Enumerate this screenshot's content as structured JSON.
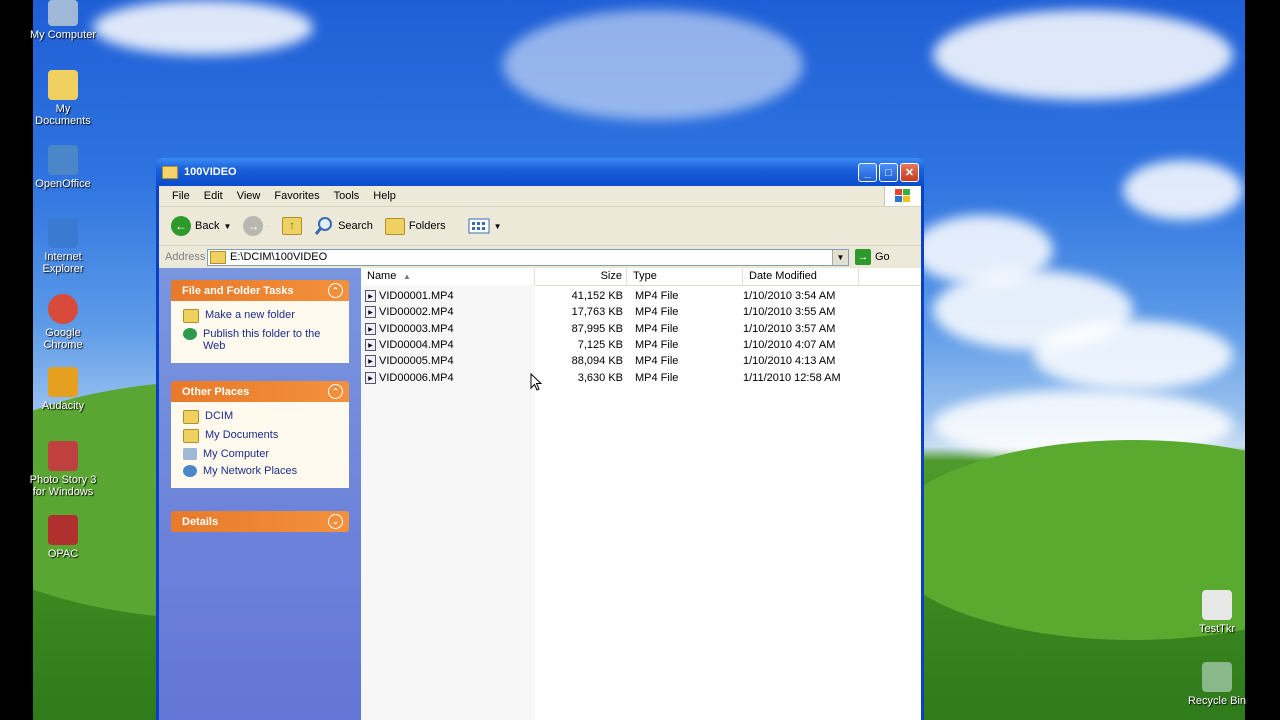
{
  "desktop": {
    "icons": [
      {
        "label": "My Computer",
        "icon": "computer-icon",
        "color": "#9fb8d8"
      },
      {
        "label": "My Documents",
        "icon": "documents-icon",
        "color": "#f0d060"
      },
      {
        "label": "OpenOffice",
        "icon": "openoffice-icon",
        "color": "#4a86c8"
      },
      {
        "label": "Internet Explorer",
        "icon": "ie-icon",
        "color": "#3a7ad0"
      },
      {
        "label": "Google Chrome",
        "icon": "chrome-icon",
        "color": "#d84a3a"
      },
      {
        "label": "Audacity",
        "icon": "audacity-icon",
        "color": "#e6a020"
      },
      {
        "label": "Photo Story 3 for Windows",
        "icon": "photostory-icon",
        "color": "#c04040"
      },
      {
        "label": "OPAC",
        "icon": "opac-icon",
        "color": "#b03030"
      },
      {
        "label": "TestTkr",
        "icon": "testtkr-icon",
        "color": "#e8e8e8"
      },
      {
        "label": "Recycle Bin",
        "icon": "recycle-bin-icon",
        "color": "#8ab88a"
      }
    ]
  },
  "window": {
    "title": "100VIDEO",
    "menu": [
      "File",
      "Edit",
      "View",
      "Favorites",
      "Tools",
      "Help"
    ],
    "toolbar": {
      "back": "Back",
      "search": "Search",
      "folders": "Folders"
    },
    "address": {
      "label": "Address",
      "value": "E:\\DCIM\\100VIDEO",
      "go": "Go"
    },
    "tasks_panel": {
      "title": "File and Folder Tasks",
      "items": [
        "Make a new folder",
        "Publish this folder to the Web"
      ]
    },
    "places_panel": {
      "title": "Other Places",
      "items": [
        "DCIM",
        "My Documents",
        "My Computer",
        "My Network Places"
      ]
    },
    "details_panel": {
      "title": "Details"
    },
    "columns": {
      "name": "Name",
      "size": "Size",
      "type": "Type",
      "date": "Date Modified"
    },
    "files": [
      {
        "name": "VID00001.MP4",
        "size": "41,152 KB",
        "type": "MP4 File",
        "date": "1/10/2010 3:54 AM"
      },
      {
        "name": "VID00002.MP4",
        "size": "17,763 KB",
        "type": "MP4 File",
        "date": "1/10/2010 3:55 AM"
      },
      {
        "name": "VID00003.MP4",
        "size": "87,995 KB",
        "type": "MP4 File",
        "date": "1/10/2010 3:57 AM"
      },
      {
        "name": "VID00004.MP4",
        "size": "7,125 KB",
        "type": "MP4 File",
        "date": "1/10/2010 4:07 AM"
      },
      {
        "name": "VID00005.MP4",
        "size": "88,094 KB",
        "type": "MP4 File",
        "date": "1/10/2010 4:13 AM"
      },
      {
        "name": "VID00006.MP4",
        "size": "3,630 KB",
        "type": "MP4 File",
        "date": "1/11/2010 12:58 AM"
      }
    ]
  }
}
